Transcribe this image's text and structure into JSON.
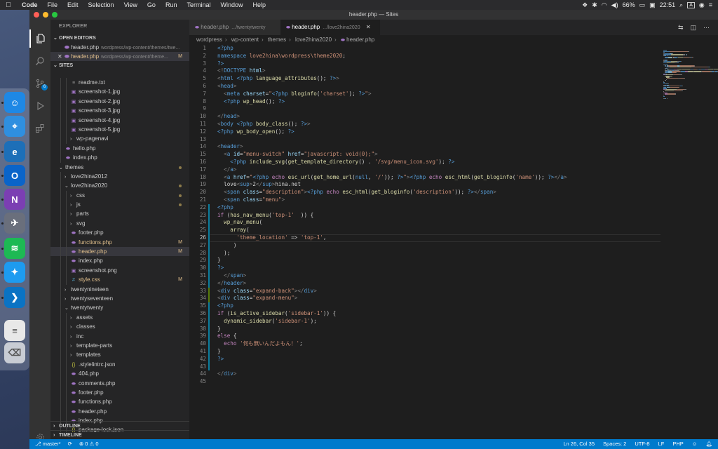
{
  "menubar": {
    "app": "Code",
    "items": [
      "File",
      "Edit",
      "Selection",
      "View",
      "Go",
      "Run",
      "Terminal",
      "Window",
      "Help"
    ],
    "battery": "66%",
    "time": "22:51",
    "input_indicator": "A",
    "status_icons": [
      "dropbox-icon",
      "wifi-icon",
      "volume-icon",
      "battery-icon",
      "search-icon",
      "siri-icon"
    ]
  },
  "window": {
    "title": "header.php — Sites"
  },
  "dock": {
    "apps": [
      {
        "name": "finder-icon",
        "color": "#1e88e5",
        "glyph": "☺"
      },
      {
        "name": "safari-icon",
        "color": "#2f8fe0",
        "glyph": "⌖"
      },
      {
        "name": "edge-beta-icon",
        "color": "#1d6fb8",
        "glyph": "e"
      },
      {
        "name": "outlook-icon",
        "color": "#0a64c9",
        "glyph": "O"
      },
      {
        "name": "onenote-icon",
        "color": "#7b3fb3",
        "glyph": "N"
      },
      {
        "name": "launchpad-icon",
        "color": "#6a6f7c",
        "glyph": "✈"
      },
      {
        "name": "spotify-icon",
        "color": "#1db954",
        "glyph": "≋"
      },
      {
        "name": "twitter-icon",
        "color": "#1d9bf0",
        "glyph": "✦"
      },
      {
        "name": "vscode-icon",
        "color": "#0a73c4",
        "glyph": "❯"
      },
      {
        "name": "document-icon",
        "color": "#e8e8e8",
        "glyph": "≡"
      },
      {
        "name": "trash-icon",
        "color": "#c8ccd4",
        "glyph": "⌫"
      }
    ]
  },
  "explorer": {
    "title": "EXPLORER",
    "open_editors_label": "OPEN EDITORS",
    "open_editors": [
      {
        "name": "header.php",
        "path": "wordpress/wp-content/themes/twe...",
        "status": ""
      },
      {
        "name": "header.php",
        "path": "wordpress/wp-content/theme...",
        "status": "M"
      }
    ],
    "sites_label": "SITES",
    "tree": [
      {
        "name": "readme.txt",
        "depth": 2,
        "kind": "file",
        "icon": "text"
      },
      {
        "name": "screenshot-1.jpg",
        "depth": 2,
        "kind": "file",
        "icon": "image"
      },
      {
        "name": "screenshot-2.jpg",
        "depth": 2,
        "kind": "file",
        "icon": "image"
      },
      {
        "name": "screenshot-3.jpg",
        "depth": 2,
        "kind": "file",
        "icon": "image"
      },
      {
        "name": "screenshot-4.jpg",
        "depth": 2,
        "kind": "file",
        "icon": "image"
      },
      {
        "name": "screenshot-5.jpg",
        "depth": 2,
        "kind": "file",
        "icon": "image"
      },
      {
        "name": "wp-pagenavi",
        "depth": 2,
        "kind": "folder",
        "open": false
      },
      {
        "name": "hello.php",
        "depth": 1,
        "kind": "file",
        "icon": "php"
      },
      {
        "name": "index.php",
        "depth": 1,
        "kind": "file",
        "icon": "php"
      },
      {
        "name": "themes",
        "depth": 0,
        "kind": "folder",
        "open": true,
        "mark": "dot"
      },
      {
        "name": "love2hina2012",
        "depth": 1,
        "kind": "folder",
        "open": false
      },
      {
        "name": "love2hina2020",
        "depth": 1,
        "kind": "folder",
        "open": true,
        "mark": "dot"
      },
      {
        "name": "css",
        "depth": 2,
        "kind": "folder",
        "open": false,
        "mark": "dot"
      },
      {
        "name": "js",
        "depth": 2,
        "kind": "folder",
        "open": false,
        "mark": "dot"
      },
      {
        "name": "parts",
        "depth": 2,
        "kind": "folder",
        "open": false
      },
      {
        "name": "svg",
        "depth": 2,
        "kind": "folder",
        "open": false
      },
      {
        "name": "footer.php",
        "depth": 2,
        "kind": "file",
        "icon": "php"
      },
      {
        "name": "functions.php",
        "depth": 2,
        "kind": "file",
        "icon": "php",
        "status": "M"
      },
      {
        "name": "header.php",
        "depth": 2,
        "kind": "file",
        "icon": "php",
        "status": "M",
        "selected": true
      },
      {
        "name": "index.php",
        "depth": 2,
        "kind": "file",
        "icon": "php"
      },
      {
        "name": "screenshot.png",
        "depth": 2,
        "kind": "file",
        "icon": "image"
      },
      {
        "name": "style.css",
        "depth": 2,
        "kind": "file",
        "icon": "css",
        "status": "M"
      },
      {
        "name": "twentynineteen",
        "depth": 1,
        "kind": "folder",
        "open": false
      },
      {
        "name": "twentyseventeen",
        "depth": 1,
        "kind": "folder",
        "open": false
      },
      {
        "name": "twentytwenty",
        "depth": 1,
        "kind": "folder",
        "open": true
      },
      {
        "name": "assets",
        "depth": 2,
        "kind": "folder",
        "open": false
      },
      {
        "name": "classes",
        "depth": 2,
        "kind": "folder",
        "open": false
      },
      {
        "name": "inc",
        "depth": 2,
        "kind": "folder",
        "open": false
      },
      {
        "name": "template-parts",
        "depth": 2,
        "kind": "folder",
        "open": false
      },
      {
        "name": "templates",
        "depth": 2,
        "kind": "folder",
        "open": false
      },
      {
        "name": ".stylelintrc.json",
        "depth": 2,
        "kind": "file",
        "icon": "json"
      },
      {
        "name": "404.php",
        "depth": 2,
        "kind": "file",
        "icon": "php"
      },
      {
        "name": "comments.php",
        "depth": 2,
        "kind": "file",
        "icon": "php"
      },
      {
        "name": "footer.php",
        "depth": 2,
        "kind": "file",
        "icon": "php"
      },
      {
        "name": "functions.php",
        "depth": 2,
        "kind": "file",
        "icon": "php"
      },
      {
        "name": "header.php",
        "depth": 2,
        "kind": "file",
        "icon": "php"
      },
      {
        "name": "index.php",
        "depth": 2,
        "kind": "file",
        "icon": "php"
      },
      {
        "name": "package-lock.json",
        "depth": 2,
        "kind": "file",
        "icon": "json"
      }
    ],
    "outline_label": "OUTLINE",
    "timeline_label": "TIMELINE"
  },
  "tabs": [
    {
      "name": "header.php",
      "path": ".../twentytwenty",
      "active": false
    },
    {
      "name": "header.php",
      "path": ".../love2hina2020",
      "active": true
    }
  ],
  "breadcrumb": [
    "wordpress",
    "wp-content",
    "themes",
    "love2hina2020",
    "header.php"
  ],
  "code_lines": [
    [
      [
        "php",
        "<?php"
      ]
    ],
    [
      [
        "kw",
        "namespace "
      ],
      [
        "ns",
        "love2hina\\wordpress\\theme2020"
      ],
      [
        "",
        "; "
      ]
    ],
    [
      [
        "php",
        "?>"
      ]
    ],
    [
      [
        "br",
        "<!"
      ],
      [
        "tg",
        "DOCTYPE "
      ],
      [
        "at",
        "html"
      ],
      [
        "br",
        ">"
      ]
    ],
    [
      [
        "br",
        "<"
      ],
      [
        "tg",
        "html "
      ],
      [
        "php",
        "<?php "
      ],
      [
        "fn",
        "language_attributes"
      ],
      [
        "",
        "(); "
      ],
      [
        "php",
        "?>"
      ],
      [
        "br",
        ">"
      ]
    ],
    [
      [
        "br",
        "<"
      ],
      [
        "tg",
        "head"
      ],
      [
        "br",
        ">"
      ]
    ],
    [
      [
        "",
        "  "
      ],
      [
        "br",
        "<"
      ],
      [
        "tg",
        "meta "
      ],
      [
        "at",
        "charset"
      ],
      [
        "",
        "="
      ],
      [
        "str",
        "\""
      ],
      [
        "php",
        "<?php "
      ],
      [
        "fn",
        "bloginfo"
      ],
      [
        "",
        "("
      ],
      [
        "str",
        "'charset'"
      ],
      [
        "",
        "); "
      ],
      [
        "php",
        "?>"
      ],
      [
        "str",
        "\""
      ],
      [
        "br",
        ">"
      ]
    ],
    [
      [
        "",
        "  "
      ],
      [
        "php",
        "<?php "
      ],
      [
        "fn",
        "wp_head"
      ],
      [
        "",
        "(); "
      ],
      [
        "php",
        "?>"
      ]
    ],
    [
      [
        "",
        ""
      ]
    ],
    [
      [
        "br",
        "</"
      ],
      [
        "tg",
        "head"
      ],
      [
        "br",
        ">"
      ]
    ],
    [
      [
        "br",
        "<"
      ],
      [
        "tg",
        "body "
      ],
      [
        "php",
        "<?php "
      ],
      [
        "fn",
        "body_class"
      ],
      [
        "",
        "(); "
      ],
      [
        "php",
        "?>"
      ],
      [
        "br",
        ">"
      ]
    ],
    [
      [
        "php",
        "<?php "
      ],
      [
        "fn",
        "wp_body_open"
      ],
      [
        "",
        "(); "
      ],
      [
        "php",
        "?>"
      ]
    ],
    [
      [
        "",
        ""
      ]
    ],
    [
      [
        "br",
        "<"
      ],
      [
        "tg",
        "header"
      ],
      [
        "br",
        ">"
      ]
    ],
    [
      [
        "",
        "  "
      ],
      [
        "br",
        "<"
      ],
      [
        "tg",
        "a "
      ],
      [
        "at",
        "id"
      ],
      [
        "",
        "="
      ],
      [
        "str",
        "\"menu-switch\" "
      ],
      [
        "at",
        "href"
      ],
      [
        "",
        "="
      ],
      [
        "str",
        "\"javascript: void(0);\""
      ],
      [
        "br",
        ">"
      ]
    ],
    [
      [
        "",
        "    "
      ],
      [
        "php",
        "<?php "
      ],
      [
        "fn",
        "include_svg"
      ],
      [
        "",
        "("
      ],
      [
        "fn",
        "get_template_directory"
      ],
      [
        "",
        "() . "
      ],
      [
        "str",
        "'/svg/menu_icon.svg'"
      ],
      [
        "",
        "); "
      ],
      [
        "php",
        "?>"
      ]
    ],
    [
      [
        "",
        "  "
      ],
      [
        "br",
        "</"
      ],
      [
        "tg",
        "a"
      ],
      [
        "br",
        ">"
      ]
    ],
    [
      [
        "",
        "  "
      ],
      [
        "br",
        "<"
      ],
      [
        "tg",
        "a "
      ],
      [
        "at",
        "href"
      ],
      [
        "",
        "="
      ],
      [
        "str",
        "\""
      ],
      [
        "php",
        "<?php "
      ],
      [
        "ctl",
        "echo "
      ],
      [
        "fn",
        "esc_url"
      ],
      [
        "",
        "("
      ],
      [
        "fn",
        "get_home_url"
      ],
      [
        "",
        "("
      ],
      [
        "kw",
        "null"
      ],
      [
        "",
        ", "
      ],
      [
        "str",
        "'/'"
      ],
      [
        "",
        "));"
      ],
      [
        "php",
        " ?>"
      ],
      [
        "str",
        "\""
      ],
      [
        "br",
        ">"
      ],
      [
        "php",
        "<?php "
      ],
      [
        "ctl",
        "echo "
      ],
      [
        "fn",
        "esc_html"
      ],
      [
        "",
        "("
      ],
      [
        "fn",
        "get_bloginfo"
      ],
      [
        "",
        "("
      ],
      [
        "str",
        "'name'"
      ],
      [
        "",
        "));"
      ],
      [
        "php",
        " ?>"
      ],
      [
        "br",
        "</"
      ],
      [
        "tg",
        "a"
      ],
      [
        "br",
        ">"
      ]
    ],
    [
      [
        "",
        "  "
      ],
      [
        "",
        "love"
      ],
      [
        "br",
        "<"
      ],
      [
        "tg",
        "sup"
      ],
      [
        "br",
        ">"
      ],
      [
        "",
        "2"
      ],
      [
        "br",
        "</"
      ],
      [
        "tg",
        "sup"
      ],
      [
        "br",
        ">"
      ],
      [
        "",
        "hina.net"
      ]
    ],
    [
      [
        "",
        "  "
      ],
      [
        "br",
        "<"
      ],
      [
        "tg",
        "span "
      ],
      [
        "at",
        "class"
      ],
      [
        "",
        "="
      ],
      [
        "str",
        "\"description\""
      ],
      [
        "br",
        ">"
      ],
      [
        "php",
        "<?php "
      ],
      [
        "ctl",
        "echo "
      ],
      [
        "fn",
        "esc_html"
      ],
      [
        "",
        "("
      ],
      [
        "fn",
        "get_bloginfo"
      ],
      [
        "",
        "("
      ],
      [
        "str",
        "'description'"
      ],
      [
        "",
        "));"
      ],
      [
        "php",
        " ?>"
      ],
      [
        "br",
        "</"
      ],
      [
        "tg",
        "span"
      ],
      [
        "br",
        ">"
      ]
    ],
    [
      [
        "",
        "  "
      ],
      [
        "br",
        "<"
      ],
      [
        "tg",
        "span "
      ],
      [
        "at",
        "class"
      ],
      [
        "",
        "="
      ],
      [
        "str",
        "\"menu\""
      ],
      [
        "br",
        ">"
      ]
    ],
    [
      [
        "php",
        "<?php"
      ]
    ],
    [
      [
        "ctl",
        "if "
      ],
      [
        "",
        "("
      ],
      [
        "fn",
        "has_nav_menu"
      ],
      [
        "",
        "("
      ],
      [
        "str",
        "'top-1'"
      ],
      [
        "",
        "  )) {"
      ]
    ],
    [
      [
        "",
        "  "
      ],
      [
        "fn",
        "wp_nav_menu"
      ],
      [
        "",
        "("
      ]
    ],
    [
      [
        "",
        "    "
      ],
      [
        "fn",
        "array"
      ],
      [
        "",
        "("
      ]
    ],
    [
      [
        "",
        "      "
      ],
      [
        "str",
        "'theme_location' "
      ],
      [
        "",
        "=> "
      ],
      [
        "str",
        "'top-1'"
      ],
      [
        "",
        ","
      ]
    ],
    [
      [
        "",
        "    "
      ],
      [
        "",
        " )"
      ]
    ],
    [
      [
        "",
        "  "
      ],
      [
        "",
        ");"
      ]
    ],
    [
      [
        "",
        "}"
      ]
    ],
    [
      [
        "php",
        "?>"
      ]
    ],
    [
      [
        "",
        "  "
      ],
      [
        "br",
        "</"
      ],
      [
        "tg",
        "span"
      ],
      [
        "br",
        ">"
      ]
    ],
    [
      [
        "br",
        "</"
      ],
      [
        "tg",
        "header"
      ],
      [
        "br",
        ">"
      ]
    ],
    [
      [
        "br",
        "<"
      ],
      [
        "tg",
        "div "
      ],
      [
        "at",
        "class"
      ],
      [
        "",
        "="
      ],
      [
        "str",
        "\"expand-back\""
      ],
      [
        "br",
        "></"
      ],
      [
        "tg",
        "div"
      ],
      [
        "br",
        ">"
      ]
    ],
    [
      [
        "br",
        "<"
      ],
      [
        "tg",
        "div "
      ],
      [
        "at",
        "class"
      ],
      [
        "",
        "="
      ],
      [
        "str",
        "\"expand-menu\""
      ],
      [
        "br",
        ">"
      ]
    ],
    [
      [
        "php",
        "<?php"
      ]
    ],
    [
      [
        "ctl",
        "if "
      ],
      [
        "",
        "("
      ],
      [
        "fn",
        "is_active_sidebar"
      ],
      [
        "",
        "("
      ],
      [
        "str",
        "'sidebar-1'"
      ],
      [
        "",
        ")) {"
      ]
    ],
    [
      [
        "",
        "  "
      ],
      [
        "fn",
        "dynamic_sidebar"
      ],
      [
        "",
        "("
      ],
      [
        "str",
        "'sidebar-1'"
      ],
      [
        "",
        ");"
      ]
    ],
    [
      [
        "",
        "}"
      ]
    ],
    [
      [
        "ctl",
        "else "
      ],
      [
        "",
        "{"
      ]
    ],
    [
      [
        "",
        "  "
      ],
      [
        "ctl",
        "echo "
      ],
      [
        "str",
        "'何も無いんだよもん！'"
      ],
      [
        "",
        ";"
      ]
    ],
    [
      [
        "",
        "}"
      ]
    ],
    [
      [
        "php",
        "?>"
      ]
    ],
    [
      [
        "",
        ""
      ]
    ],
    [
      [
        "br",
        "</"
      ],
      [
        "tg",
        "div"
      ],
      [
        "br",
        ">"
      ]
    ],
    [
      [
        "",
        ""
      ]
    ]
  ],
  "status": {
    "branch": "master*",
    "problems": "0",
    "warnings": "0",
    "position": "Ln 26, Col 35",
    "spaces": "Spaces: 2",
    "encoding": "UTF-8",
    "eol": "LF",
    "language": "PHP"
  },
  "colors": {
    "accent": "#007acc",
    "modified": "#e2c08d",
    "gutter_added": "#587c0c",
    "gutter_modified": "#0c7d9d"
  }
}
